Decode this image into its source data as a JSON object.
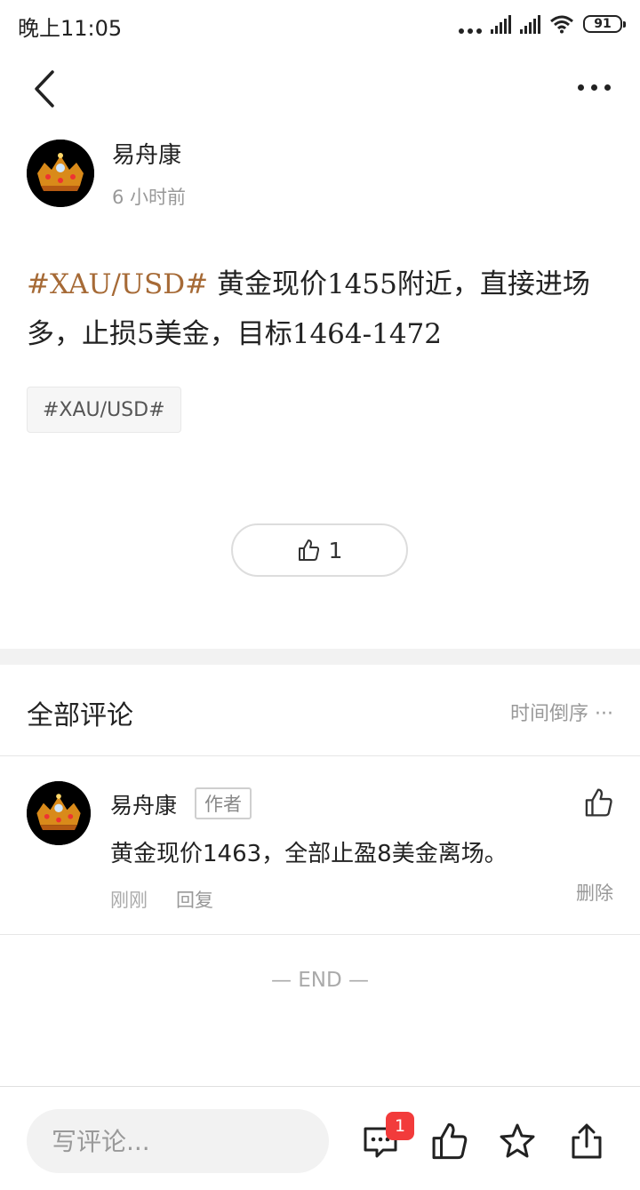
{
  "status_bar": {
    "time": "晚上11:05",
    "battery": "91"
  },
  "post": {
    "author": "易舟康",
    "time": "6 小时前",
    "hashtag": "#XAU/USD#",
    "text": " 黄金现价1455附近，直接进场多，止损5美金，目标1464-1472",
    "topic_tag": "#XAU/USD#",
    "like_count": "1"
  },
  "comments_section": {
    "title": "全部评论",
    "sort_label": "时间倒序 ···"
  },
  "comments": [
    {
      "author": "易舟康",
      "badge": "作者",
      "text": "黄金现价1463，全部止盈8美金离场。",
      "time": "刚刚",
      "reply_label": "回复",
      "delete_label": "删除"
    }
  ],
  "end_label": "— END —",
  "bottom_bar": {
    "input_placeholder": "写评论...",
    "comment_badge": "1"
  },
  "colors": {
    "accent_hashtag": "#a66a36",
    "badge_red": "#f23b3b"
  }
}
